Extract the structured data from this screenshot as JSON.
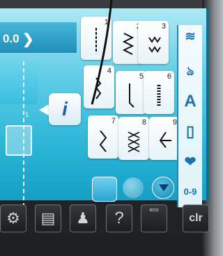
{
  "header": {
    "zoom_value": "0.0",
    "zoom_chevron": "❯"
  },
  "preview": {
    "foot_position": "1"
  },
  "info_button": {
    "label": "i"
  },
  "stitches": [
    {
      "number": "1",
      "icon": "straight-stitch-icon"
    },
    {
      "number": "2",
      "icon": "zigzag-stitch-icon"
    },
    {
      "number": "3",
      "icon": "wave-stitch-icon"
    },
    {
      "number": "4",
      "icon": "blind-stitch-icon"
    },
    {
      "number": "5",
      "icon": "hook-stitch-icon"
    },
    {
      "number": "6",
      "icon": "bar-stitch-icon"
    },
    {
      "number": "7",
      "icon": "arrow-stitch-icon"
    },
    {
      "number": "8",
      "icon": "cross-stitch-icon"
    },
    {
      "number": "9",
      "icon": "angle-stitch-icon"
    }
  ],
  "side_panel": {
    "items": [
      {
        "label": "≋",
        "icon": "zigzag-category-icon"
      },
      {
        "label": "ঌ",
        "icon": "decorative-category-icon"
      },
      {
        "label": "A",
        "icon": "alphabet-category-icon"
      },
      {
        "label": "▯",
        "icon": "buttonhole-category-icon"
      },
      {
        "label": "❤",
        "icon": "favorite-category-icon"
      },
      {
        "label": "0-9",
        "icon": "direct-number-icon"
      }
    ]
  },
  "bottom_bar": {
    "buttons": [
      {
        "name": "setup-button",
        "icon": "gear-icon",
        "label": "⚙"
      },
      {
        "name": "tutorial-button",
        "icon": "book-icon",
        "label": "▤"
      },
      {
        "name": "consultant-button",
        "icon": "dressform-icon",
        "label": "♟"
      },
      {
        "name": "help-button",
        "icon": "help-icon",
        "label": "?"
      },
      {
        "name": "eco-button",
        "icon": "eco-leaf-icon",
        "label": "eco"
      },
      {
        "name": "clear-button",
        "icon": "clr-icon",
        "label": "clr"
      }
    ]
  },
  "colors": {
    "screen_top": "#aee8f4",
    "screen_bottom": "#159fc6",
    "accent": "#1b73ab"
  }
}
